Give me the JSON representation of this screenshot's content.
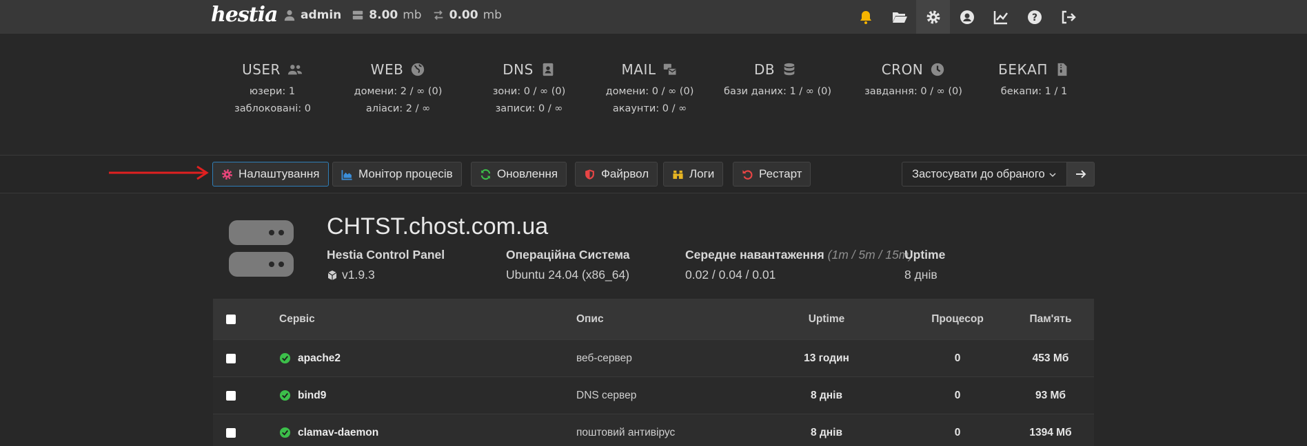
{
  "topbar": {
    "logo": "hestia",
    "user": "admin",
    "disk_value": "8.00",
    "disk_unit": "mb",
    "bandwidth_value": "0.00",
    "bandwidth_unit": "mb",
    "icons": [
      "bell-icon",
      "folder-open-icon",
      "gear-icon",
      "user-circle-icon",
      "chart-line-icon",
      "question-icon",
      "logout-icon"
    ],
    "bell_color": "#f5b400"
  },
  "stats": {
    "user": {
      "title": "USER",
      "lines": [
        "юзери: 1",
        "заблоковані: 0"
      ]
    },
    "web": {
      "title": "WEB",
      "lines": [
        "домени: 2 / ∞ (0)",
        "аліаси: 2 / ∞"
      ]
    },
    "dns": {
      "title": "DNS",
      "lines": [
        "зони: 0 / ∞ (0)",
        "записи: 0 / ∞"
      ]
    },
    "mail": {
      "title": "MAIL",
      "lines": [
        "домени: 0 / ∞ (0)",
        "акаунти: 0 / ∞"
      ]
    },
    "db": {
      "title": "DB",
      "lines": [
        "бази даних: 1 / ∞ (0)"
      ]
    },
    "cron": {
      "title": "CRON",
      "lines": [
        "завдання: 0 / ∞ (0)"
      ]
    },
    "backup": {
      "title": "БЕКАП",
      "lines": [
        "бекапи: 1 / 1"
      ]
    }
  },
  "toolbar": {
    "settings": "Налаштування",
    "monitor": "Монітор процесів",
    "updates": "Оновлення",
    "firewall": "Файрвол",
    "logs": "Логи",
    "restart": "Рестарт",
    "apply_select": "Застосувати до обраного",
    "colors": {
      "settings": "#e8457a",
      "monitor": "#3b8fdb",
      "updates": "#3cbf4a",
      "firewall": "#e84545",
      "logs": "#e8b623",
      "restart": "#e84545",
      "arrow": "#e02020"
    }
  },
  "server": {
    "hostname": "CHTST.chost.com.ua",
    "panel_label": "Hestia Control Panel",
    "panel_version": "v1.9.3",
    "os_label": "Операційна Система",
    "os_value": "Ubuntu 24.04 (x86_64)",
    "load_label": "Середне навантаження",
    "load_sub": "(1m / 5m / 15m)",
    "load_value": "0.02 / 0.04 / 0.01",
    "uptime_label": "Uptime",
    "uptime_value": "8 днів"
  },
  "table": {
    "headers": {
      "service": "Сервіс",
      "description": "Опис",
      "uptime": "Uptime",
      "cpu": "Процесор",
      "memory": "Пам'ять"
    },
    "rows": [
      {
        "service": "apache2",
        "description": "веб-сервер",
        "uptime": "13 годин",
        "cpu": "0",
        "memory": "453 Мб"
      },
      {
        "service": "bind9",
        "description": "DNS сервер",
        "uptime": "8 днів",
        "cpu": "0",
        "memory": "93 Мб"
      },
      {
        "service": "clamav-daemon",
        "description": "поштовий антивірус",
        "uptime": "8 днів",
        "cpu": "0",
        "memory": "1394 Мб"
      }
    ],
    "status_color": "#3cbf4a"
  }
}
